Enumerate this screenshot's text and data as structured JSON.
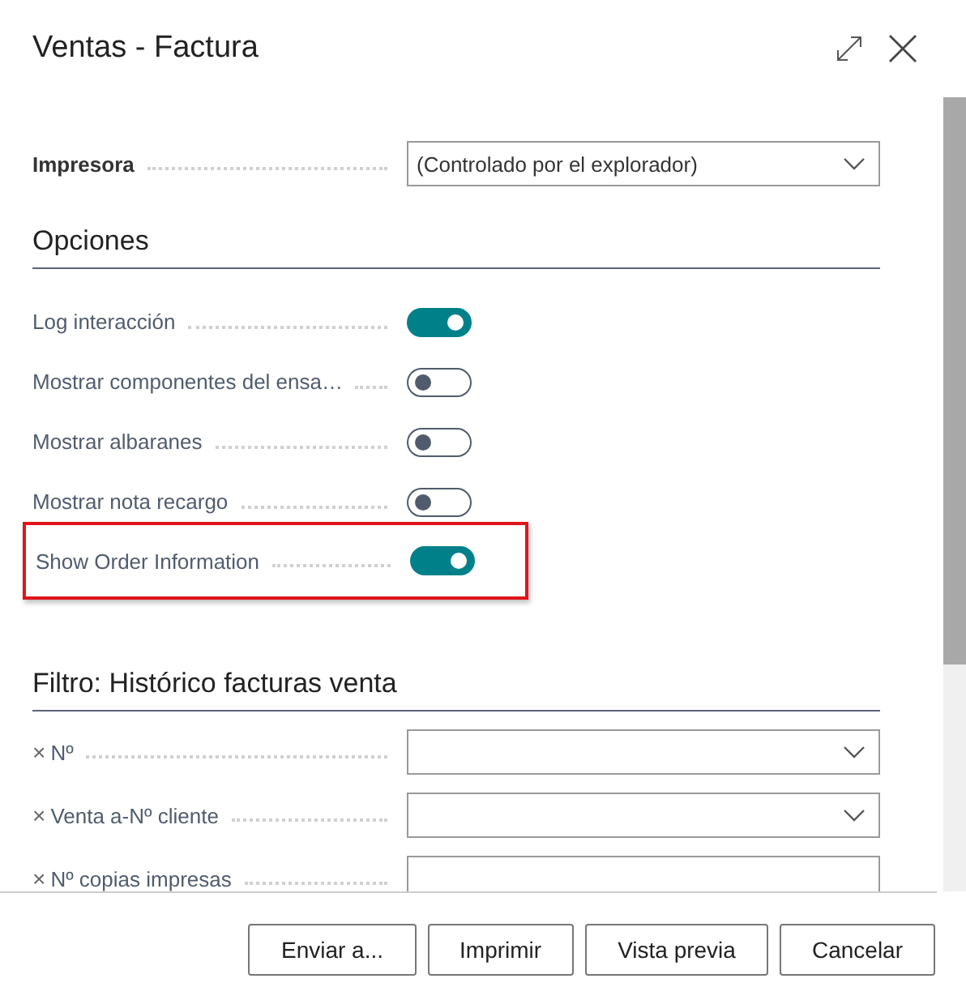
{
  "window": {
    "title": "Ventas - Factura"
  },
  "printer": {
    "label": "Impresora",
    "value": "(Controlado por el explorador)",
    "kind": "dropdown"
  },
  "options": {
    "title": "Opciones",
    "items": [
      {
        "label": "Log interacción",
        "on": true,
        "highlighted": false
      },
      {
        "label": "Mostrar componentes del ensa…",
        "on": false,
        "highlighted": false
      },
      {
        "label": "Mostrar albaranes",
        "on": false,
        "highlighted": false
      },
      {
        "label": "Mostrar nota recargo",
        "on": false,
        "highlighted": false
      },
      {
        "label": "Show Order Information",
        "on": true,
        "highlighted": true
      }
    ]
  },
  "filter": {
    "title": "Filtro: Histórico facturas venta",
    "rows": [
      {
        "remove": "×",
        "label": "Nº",
        "kind": "dropdown"
      },
      {
        "remove": "×",
        "label": "Venta a-Nº cliente",
        "kind": "dropdown"
      },
      {
        "remove": "×",
        "label": "Nº copias impresas",
        "kind": "text"
      }
    ]
  },
  "buttons": [
    "Enviar a...",
    "Imprimir",
    "Vista previa",
    "Cancelar"
  ]
}
